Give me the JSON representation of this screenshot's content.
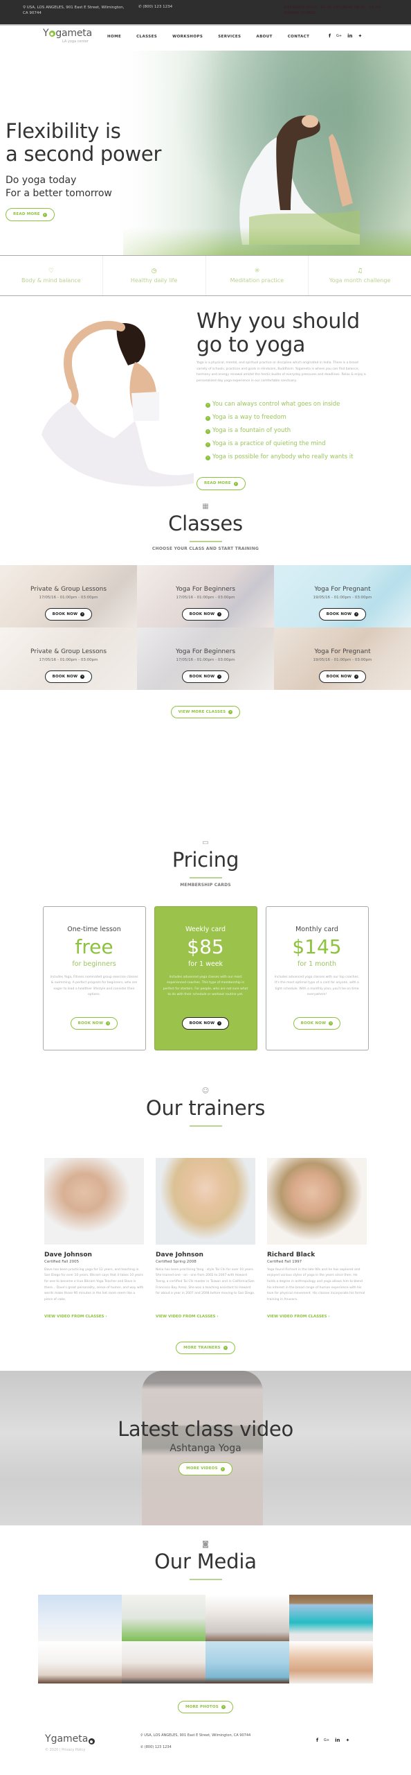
{
  "topbar": {
    "address": "USA, LOS ANGELES, 901 East E Street, Wilmington, CA 90744",
    "phone": "(800) 123 1234",
    "hours": "WEEKDAYS 08:00 - 22:00  SATURDAY 08:00 - 18:00  SUNDAY CLOSED"
  },
  "brand": {
    "name_pre": "Y",
    "name_post": "gameta",
    "tagline": "LA yoga center"
  },
  "nav": {
    "items": [
      "HOME",
      "CLASSES",
      "WORKSHOPS",
      "SERVICES",
      "ABOUT",
      "CONTACT"
    ]
  },
  "social": {
    "facebook": "f",
    "googleplus": "G+",
    "linkedin": "in",
    "twitter": "🐦"
  },
  "hero": {
    "title_line1": "Flexibility is",
    "title_line2": "a second power",
    "sub_line1": "Do yoga today",
    "sub_line2": "For a better tomorrow",
    "button": "READ MORE"
  },
  "features": [
    {
      "icon": "heart-icon",
      "glyph": "♡",
      "label": "Body & mind balance"
    },
    {
      "icon": "clock-icon",
      "glyph": "◷",
      "label": "Healthy daily life"
    },
    {
      "icon": "sunrise-icon",
      "glyph": "☼",
      "label": "Meditation practice"
    },
    {
      "icon": "bell-icon",
      "glyph": "🔔︎",
      "label": "Yoga month challenge"
    }
  ],
  "why": {
    "title_line1": "Why you should",
    "title_line2": "go to yoga",
    "description": "Yoga is a physical, mental, and spiritual practice or discipline which originated in India. There is a broad variety of schools, practices and goals in Hinduism, Buddhism. Yogameta is where you can find balance, harmony and energy renewal amidst the hectic bustle of everyday pressures and deadlines. Relax & enjoy a personalized day yoga experience in our comfortable sanctuary.",
    "points": [
      "You can always control what goes on inside",
      "Yoga is a way to freedom",
      "Yoga is a fountain of youth",
      "Yoga is a practice of quieting the mind",
      "Yoga is possible for anybody who really wants it"
    ],
    "button": "READ MORE"
  },
  "classes": {
    "icon": "calendar-icon",
    "title": "Classes",
    "tagline": "CHOOSE YOUR CLASS AND START TRAINING",
    "items": [
      {
        "title": "Private & Group Lessons",
        "date": "17/05/16 - 01:00pm - 03:00pm",
        "button": "BOOK NOW"
      },
      {
        "title": "Yoga For Beginners",
        "date": "17/05/16 - 01:00pm - 03:00pm",
        "button": "BOOK NOW"
      },
      {
        "title": "Yoga For Pregnant",
        "date": "19/05/16 - 01:00pm - 03:00pm",
        "button": "BOOK NOW"
      },
      {
        "title": "Private & Group Lessons",
        "date": "17/05/16 - 01:00pm - 03:00pm",
        "button": "BOOK NOW"
      },
      {
        "title": "Yoga For Beginners",
        "date": "17/05/16 - 01:00pm - 03:00pm",
        "button": "BOOK NOW"
      },
      {
        "title": "Yoga For Pregnant",
        "date": "19/05/16 - 01:00pm - 03:00pm",
        "button": "BOOK NOW"
      }
    ],
    "more_button": "VIEW MORE CLASSES"
  },
  "pricing": {
    "icon": "wallet-icon",
    "title": "Pricing",
    "tagline": "MEMBERSHIP CARDS",
    "cards": [
      {
        "name": "One-time lesson",
        "price": "free",
        "period": "for beginners",
        "text": "Includes Yoga, Fitness nominated group exercise classes & swimming. A perfect program for beginners, who are eager to lead a healthier lifestyle and consider their options.",
        "button": "BOOK NOW",
        "highlighted": false
      },
      {
        "name": "Weekly card",
        "price": "$85",
        "period": "for 1 week",
        "text": "Includes advanced yoga classes with our most experienced coaches. This type of membership is perfect for starters. For people, who are not sure what to do with their schedule or workout routine yet.",
        "button": "BOOK NOW",
        "highlighted": true
      },
      {
        "name": "Monthly card",
        "price": "$145",
        "period": "for 1 month",
        "text": "Includes advanced yoga classes with our top coaches. It's the most optimal type of a card for anyone, with a tight schedule. With a monthly plan, you'll be on time everywhere!",
        "button": "BOOK NOW",
        "highlighted": false
      }
    ]
  },
  "trainers": {
    "icon": "user-icon",
    "title": "Our trainers",
    "items": [
      {
        "name": "Dave Johnson",
        "cert": "Certified Fall 2005",
        "bio": "Dave has been practicing yoga for 12 years, and teaching in San Diego for over 10 years. Bikram says that it takes 10 years for one to become a true Bikram Yoga Teacher and Dave is there... Dave's great personality, sense of humor, and way with words make those 90 minutes in the hot room seem like a piece of cake.",
        "link": "VIEW VIDEO FROM CLASSES"
      },
      {
        "name": "Dave Johnson",
        "cert": "Certified Spring 2008",
        "bio": "Nelia has been practicing Yang - style Tai Chi for over 10 years. She trained one - on - one from 2002 to 2007 with Howard Tseng, a certified Tai Chi master in Taiwan and in California(San Francisco Bay Area). She was a teaching assistant to Howard for about a year in 2007 and 2008 before moving to San Diego.",
        "link": "VIEW VIDEO FROM CLASSES"
      },
      {
        "name": "Richard Black",
        "cert": "Certified Fall 1997",
        "bio": "Yoga found Richard in the late 90s and he has explored and enjoyed various styles of yoga in the years since then. He holds a degree in anthropology and yoga allows him to blend his interest in the broad range of human experience with his love for physical movement. His classes incorporate his formal training in Anusara.",
        "link": "VIEW VIDEO FROM CLASSES"
      }
    ],
    "more_button": "MORE TRAINERS"
  },
  "video": {
    "title": "Latest class video",
    "subtitle": "Ashtanga Yoga",
    "button": "MORE VIDEOS"
  },
  "media": {
    "icon": "camera-icon",
    "title": "Our Media",
    "photos": [
      "yoga-photo-1",
      "yoga-photo-2",
      "yoga-photo-3",
      "yoga-photo-4",
      "yoga-photo-5",
      "yoga-photo-6",
      "yoga-photo-7",
      "yoga-photo-8"
    ],
    "more_button": "MORE PHOTOS"
  },
  "footer": {
    "copyright": "© 2020 | Privacy Policy",
    "address": "USA, LOS ANGELES, 901 East E Street, Wilmington, CA 90744",
    "phone": "(800) 123 1234"
  },
  "colors": {
    "accent": "#8dc23f",
    "topbar": "#2e2e2e",
    "highlight_card": "#9bc24b"
  }
}
